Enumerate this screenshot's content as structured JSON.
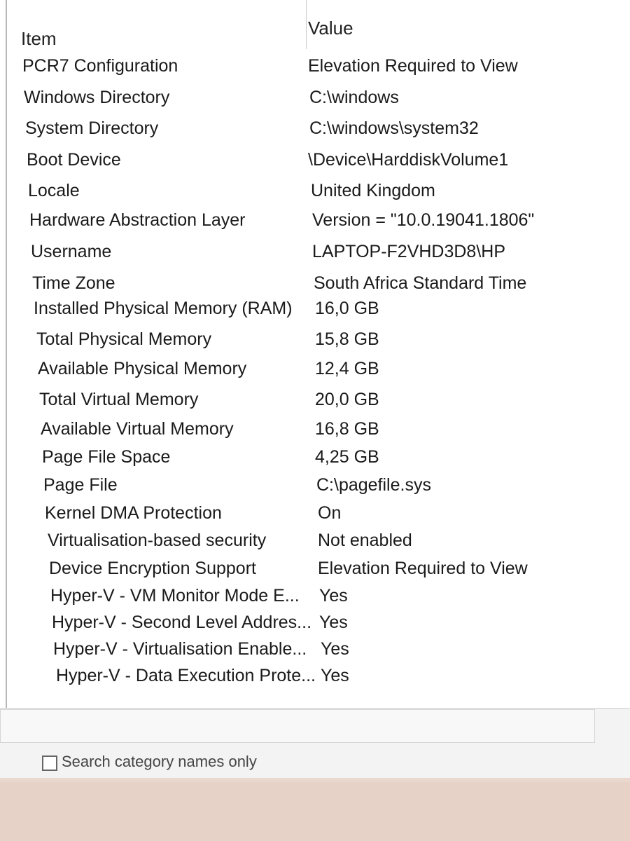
{
  "columns": {
    "item": "Item",
    "value": "Value"
  },
  "rows": [
    {
      "item": "PCR7 Configuration",
      "value": "Elevation Required to View"
    },
    {
      "item": "Windows Directory",
      "value": "C:\\windows"
    },
    {
      "item": "System Directory",
      "value": "C:\\windows\\system32"
    },
    {
      "item": "Boot Device",
      "value": "\\Device\\HarddiskVolume1"
    },
    {
      "item": "Locale",
      "value": "United Kingdom"
    },
    {
      "item": "Hardware Abstraction Layer",
      "value": "Version = \"10.0.19041.1806\""
    },
    {
      "item": "Username",
      "value": "LAPTOP-F2VHD3D8\\HP"
    },
    {
      "item": "Time Zone",
      "value": "South Africa Standard Time"
    },
    {
      "item": "Installed Physical Memory (RAM)",
      "value": "16,0 GB"
    },
    {
      "item": "Total Physical Memory",
      "value": "15,8 GB"
    },
    {
      "item": "Available Physical Memory",
      "value": "12,4 GB"
    },
    {
      "item": "Total Virtual Memory",
      "value": "20,0 GB"
    },
    {
      "item": "Available Virtual Memory",
      "value": "16,8 GB"
    },
    {
      "item": "Page File Space",
      "value": "4,25 GB"
    },
    {
      "item": "Page File",
      "value": "C:\\pagefile.sys"
    },
    {
      "item": "Kernel DMA Protection",
      "value": "On"
    },
    {
      "item": "Virtualisation-based security",
      "value": "Not enabled"
    },
    {
      "item": "Device Encryption Support",
      "value": "Elevation Required to View"
    },
    {
      "item": "Hyper-V - VM Monitor Mode E...",
      "value": "Yes"
    },
    {
      "item": "Hyper-V - Second Level Addres...",
      "value": "Yes"
    },
    {
      "item": "Hyper-V - Virtualisation Enable...",
      "value": "Yes"
    },
    {
      "item": "Hyper-V - Data Execution Prote...",
      "value": "Yes"
    }
  ],
  "search": {
    "checkbox_label": "Search category names only",
    "checked": false
  }
}
